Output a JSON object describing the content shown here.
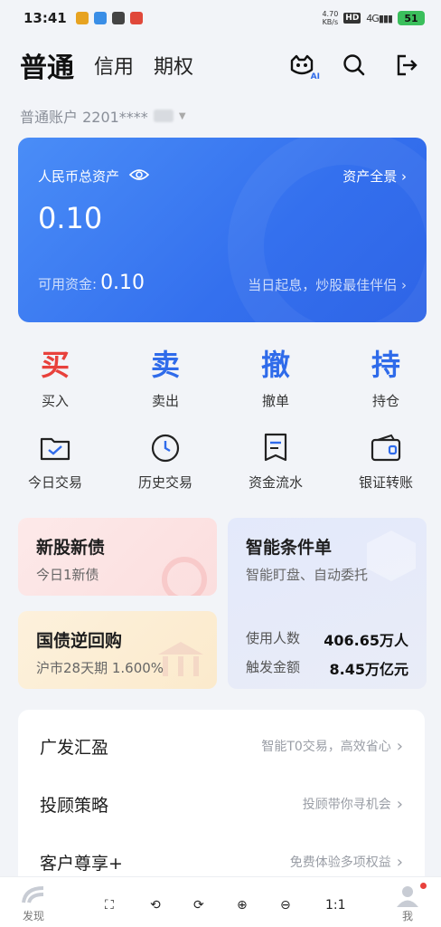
{
  "status_bar": {
    "time": "13:41",
    "net_speed_value": "4.70",
    "net_speed_unit": "KB/s",
    "hd": "HD",
    "signal": "4G",
    "battery": "51"
  },
  "header": {
    "tabs": [
      "普通",
      "信用",
      "期权"
    ],
    "ai_label": "AI"
  },
  "account": {
    "label": "普通账户 2201****"
  },
  "asset_card": {
    "title": "人民币总资产",
    "overview": "资产全景",
    "total": "0.10",
    "available_label": "可用资金:",
    "available_value": "0.10",
    "slogan": "当日起息，炒股最佳伴侣"
  },
  "trade_actions": [
    {
      "char": "买",
      "label": "买入",
      "color": "#e8413c"
    },
    {
      "char": "卖",
      "label": "卖出",
      "color": "#2f6bea"
    },
    {
      "char": "撤",
      "label": "撤单",
      "color": "#2f6bea"
    },
    {
      "char": "持",
      "label": "持仓",
      "color": "#2f6bea"
    }
  ],
  "functions": [
    {
      "label": "今日交易",
      "icon": "folder-check-icon"
    },
    {
      "label": "历史交易",
      "icon": "history-clock-icon"
    },
    {
      "label": "资金流水",
      "icon": "statement-icon"
    },
    {
      "label": "银证转账",
      "icon": "wallet-icon"
    }
  ],
  "cards": {
    "ipo": {
      "title": "新股新债",
      "sub": "今日1新债"
    },
    "repo": {
      "title": "国债逆回购",
      "sub": "沪市28天期 1.600%"
    },
    "smart": {
      "title": "智能条件单",
      "sub": "智能盯盘、自动委托",
      "users_label": "使用人数",
      "users_value": "406.65万人",
      "amount_label": "触发金额",
      "amount_value": "8.45万亿元"
    }
  },
  "list": [
    {
      "name": "广发汇盈",
      "desc": "智能T0交易，高效省心"
    },
    {
      "name": "投顾策略",
      "desc": "投顾带你寻机会"
    },
    {
      "name": "客户尊享+",
      "desc": "免费体验多项权益"
    }
  ],
  "bottom_nav": {
    "discover": "发现",
    "me": "我",
    "zoom_ratio": "1:1"
  },
  "colors": {
    "accent_blue": "#3470ee",
    "buy_red": "#e8413c"
  }
}
